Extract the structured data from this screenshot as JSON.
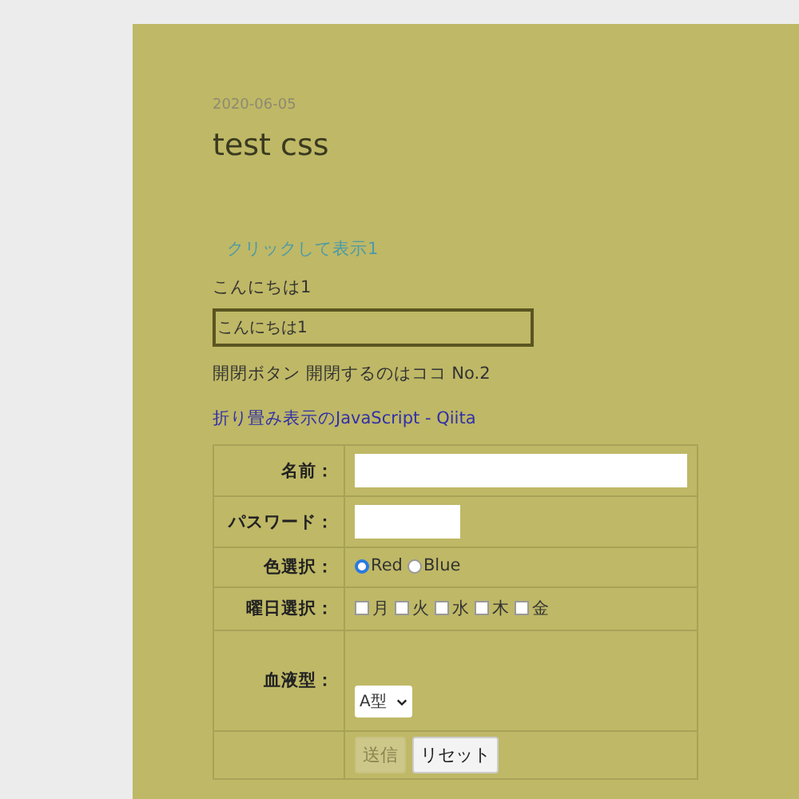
{
  "post": {
    "date": "2020-06-05",
    "title": "test css",
    "toggle_link": "クリックして表示1",
    "greeting": "こんにちは1",
    "box_text": "こんにちは1",
    "caption": "開閉ボタン 開閉するのはココ No.2",
    "link": "折り畳み表示のJavaScript - Qiita"
  },
  "form": {
    "rows": [
      {
        "kind": "text",
        "label": "名前："
      },
      {
        "kind": "password",
        "label": "パスワード："
      },
      {
        "kind": "radio",
        "label": "色選択：",
        "options": [
          {
            "label": "Red",
            "selected": true
          },
          {
            "label": "Blue",
            "selected": false
          }
        ]
      },
      {
        "kind": "checkbox",
        "label": "曜日選択：",
        "options": [
          {
            "label": "月",
            "checked": false
          },
          {
            "label": "火",
            "checked": false
          },
          {
            "label": "水",
            "checked": false
          },
          {
            "label": "木",
            "checked": false
          },
          {
            "label": "金",
            "checked": false
          }
        ]
      },
      {
        "kind": "select",
        "label": "血液型：",
        "value": "A型"
      },
      {
        "kind": "buttons",
        "buttons": [
          {
            "label": "送信",
            "disabled": true
          },
          {
            "label": "リセット",
            "disabled": false
          }
        ]
      }
    ]
  }
}
